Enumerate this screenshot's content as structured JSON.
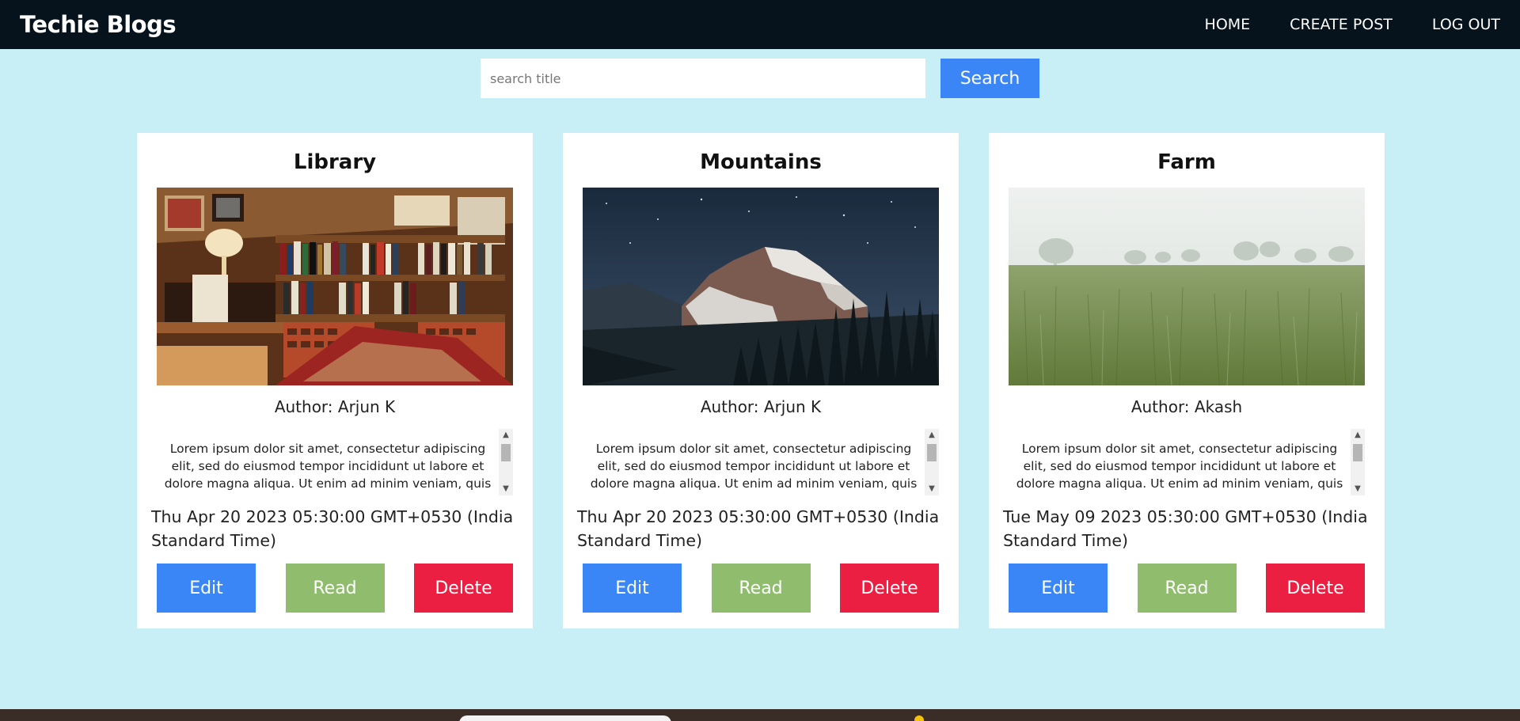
{
  "navbar": {
    "brand": "Techie Blogs",
    "links": [
      {
        "label": "HOME"
      },
      {
        "label": "CREATE POST"
      },
      {
        "label": "LOG OUT"
      }
    ]
  },
  "search": {
    "placeholder": "search title",
    "value": "",
    "button_label": "Search"
  },
  "posts": [
    {
      "title": "Library",
      "author": "Author: Arjun K",
      "image": "library-photo",
      "body": "Lorem ipsum dolor sit amet, consectetur adipiscing elit, sed do eiusmod tempor incididunt ut labore et dolore magna aliqua. Ut enim ad minim veniam, quis",
      "date": "Thu Apr 20 2023 05:30:00 GMT+0530 (India Standard Time)",
      "edit_label": "Edit",
      "read_label": "Read",
      "delete_label": "Delete"
    },
    {
      "title": "Mountains",
      "author": "Author: Arjun K",
      "image": "mountain-photo",
      "body": "Lorem ipsum dolor sit amet, consectetur adipiscing elit, sed do eiusmod tempor incididunt ut labore et dolore magna aliqua. Ut enim ad minim veniam, quis",
      "date": "Thu Apr 20 2023 05:30:00 GMT+0530 (India Standard Time)",
      "edit_label": "Edit",
      "read_label": "Read",
      "delete_label": "Delete"
    },
    {
      "title": "Farm",
      "author": "Author: Akash",
      "image": "farm-photo",
      "body": "Lorem ipsum dolor sit amet, consectetur adipiscing elit, sed do eiusmod tempor incididunt ut labore et dolore magna aliqua. Ut enim ad minim veniam, quis",
      "date": "Tue May 09 2023 05:30:00 GMT+0530 (India Standard Time)",
      "edit_label": "Edit",
      "read_label": "Read",
      "delete_label": "Delete"
    }
  ],
  "colors": {
    "navbar_bg": "#06121c",
    "page_bg": "#c9eff6",
    "edit": "#3b86f7",
    "read": "#8fbd6d",
    "delete": "#ea1f42"
  }
}
